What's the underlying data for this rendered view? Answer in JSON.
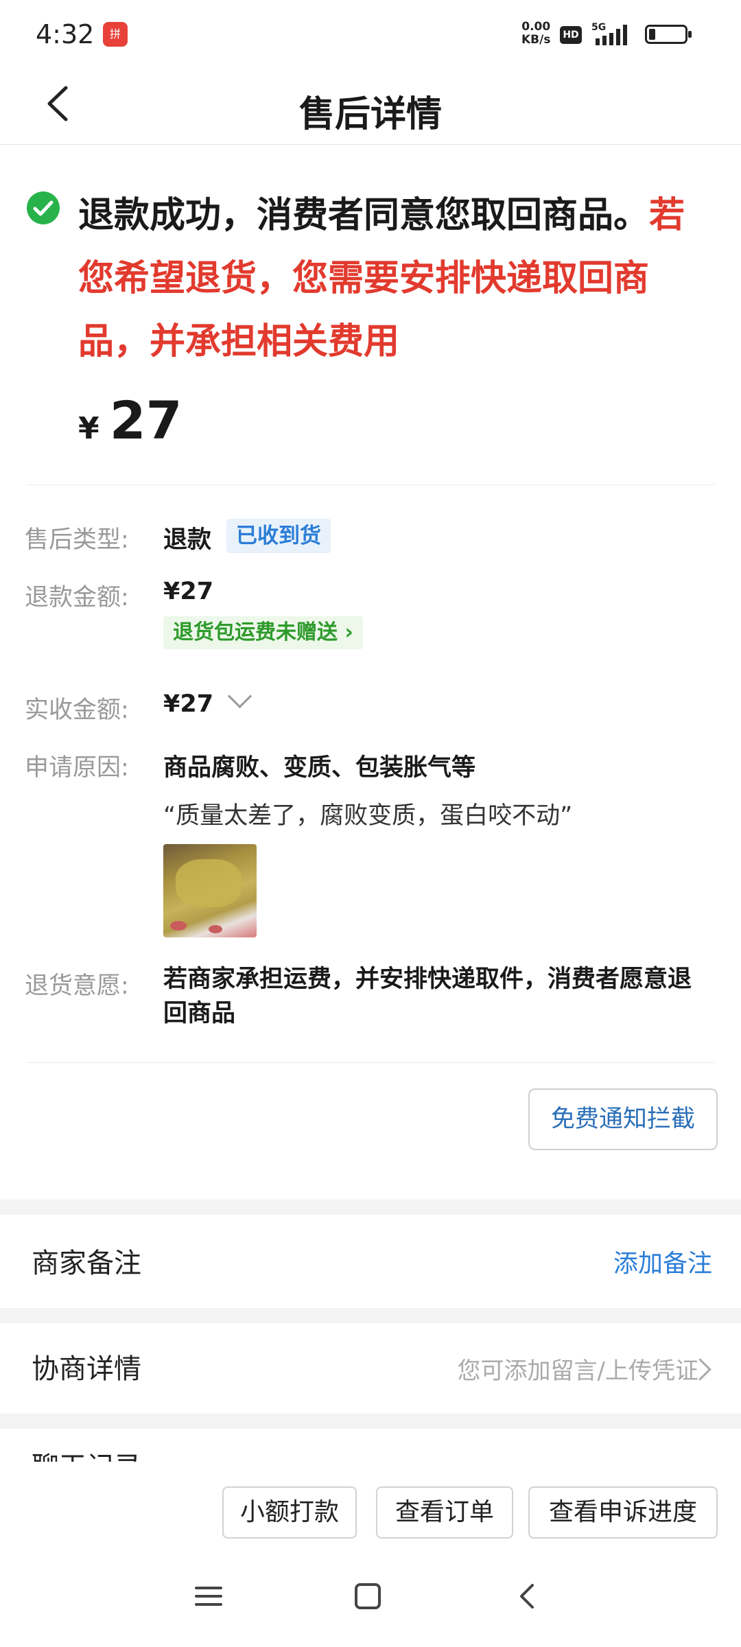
{
  "status_bar": {
    "time": "4:32",
    "app_badge": "拼多多",
    "net_speed_value": "0.00",
    "net_speed_unit": "KB/s",
    "hd": "HD",
    "network": "5G"
  },
  "header": {
    "title": "售后详情"
  },
  "status": {
    "main_text": "退款成功，消费者同意您取回商品。",
    "red_text": "若您希望退货，您需要安排快递取回商品，并承担相关费用",
    "currency": "¥",
    "amount": "27"
  },
  "details": {
    "type_label": "售后类型:",
    "type_value": "退款",
    "type_tag": "已收到货",
    "refund_label": "退款金额:",
    "refund_value": "¥27",
    "refund_tag": "退货包运费未赠送 ›",
    "received_label": "实收金额:",
    "received_value": "¥27",
    "reason_label": "申请原因:",
    "reason_value": "商品腐败、变质、包装胀气等",
    "reason_quote": "“质量太差了，腐败变质，蛋白咬不动”",
    "wish_label": "退货意愿:",
    "wish_value": "若商家承担运费，并安排快递取件，消费者愿意退回商品"
  },
  "intercept_button": "免费通知拦截",
  "merchant_note": {
    "title": "商家备注",
    "action": "添加备注"
  },
  "negotiation": {
    "title": "协商详情",
    "hint": "您可添加留言/上传凭证"
  },
  "partial_row": "聊天记录",
  "bottom_buttons": {
    "small_pay": "小额打款",
    "view_order": "查看订单",
    "view_appeal": "查看申诉进度"
  },
  "colors": {
    "accent_red": "#e23a2e",
    "accent_blue": "#2b7dd7",
    "accent_green": "#2e9a2c",
    "check_green": "#27b24a"
  },
  "icons": [
    "back-arrow-icon",
    "check-circle-icon",
    "chevron-down-icon",
    "chevron-right-icon",
    "menu-icon",
    "home-square-icon",
    "system-back-icon",
    "signal-icon",
    "battery-icon"
  ]
}
